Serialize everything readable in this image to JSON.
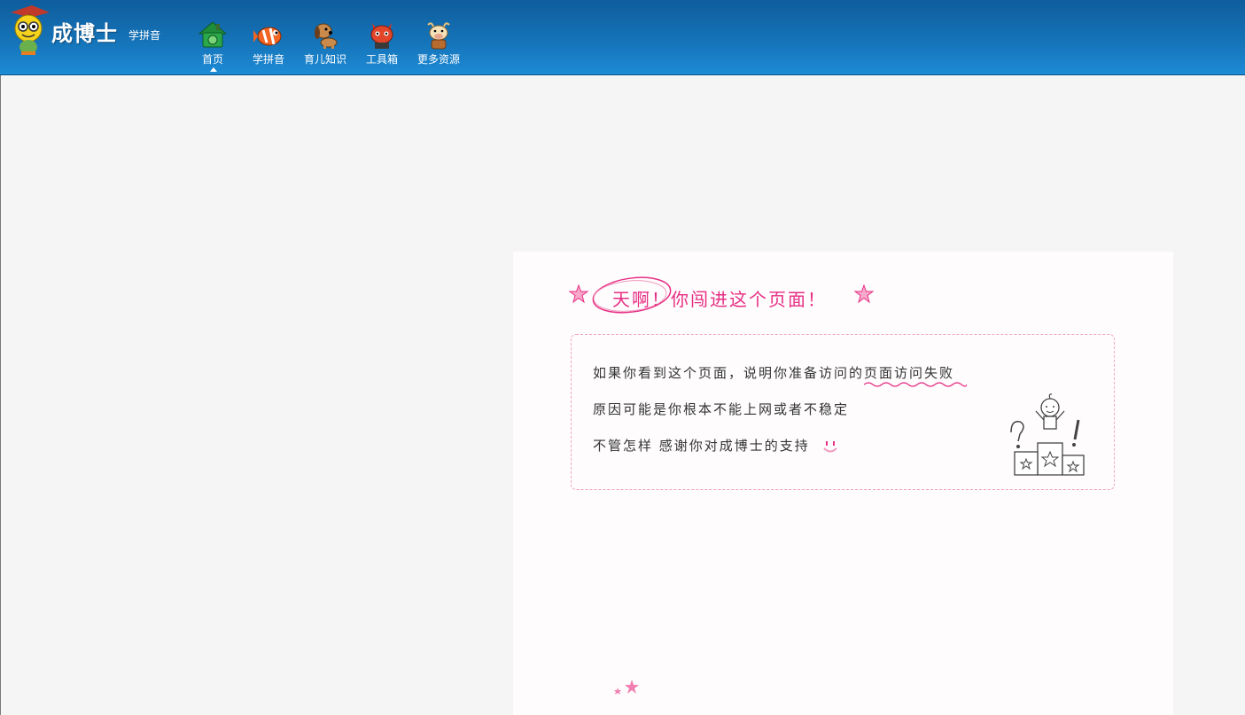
{
  "header": {
    "brand": "成博士",
    "brand_sub": "学拼音",
    "nav": [
      {
        "label": "首页",
        "icon": "home-icon"
      },
      {
        "label": "学拼音",
        "icon": "fish-icon"
      },
      {
        "label": "育儿知识",
        "icon": "dog-icon"
      },
      {
        "label": "工具箱",
        "icon": "cat-icon"
      },
      {
        "label": "更多资源",
        "icon": "cow-icon"
      }
    ],
    "active_index": 0
  },
  "error": {
    "title": "天啊！你闯进这个页面！",
    "line1_prefix": "如果你看到这个页面，说明你准备访问的",
    "line1_highlight": "页面访问失败",
    "line2": "原因可能是你根本不能上网或者不稳定",
    "line3": "不管怎样 感谢你对成博士的支持"
  },
  "colors": {
    "header_top": "#0f5d9c",
    "header_bottom": "#1d8bd6",
    "accent_pink": "#e72e83",
    "border_pink": "#f2a6c6"
  }
}
